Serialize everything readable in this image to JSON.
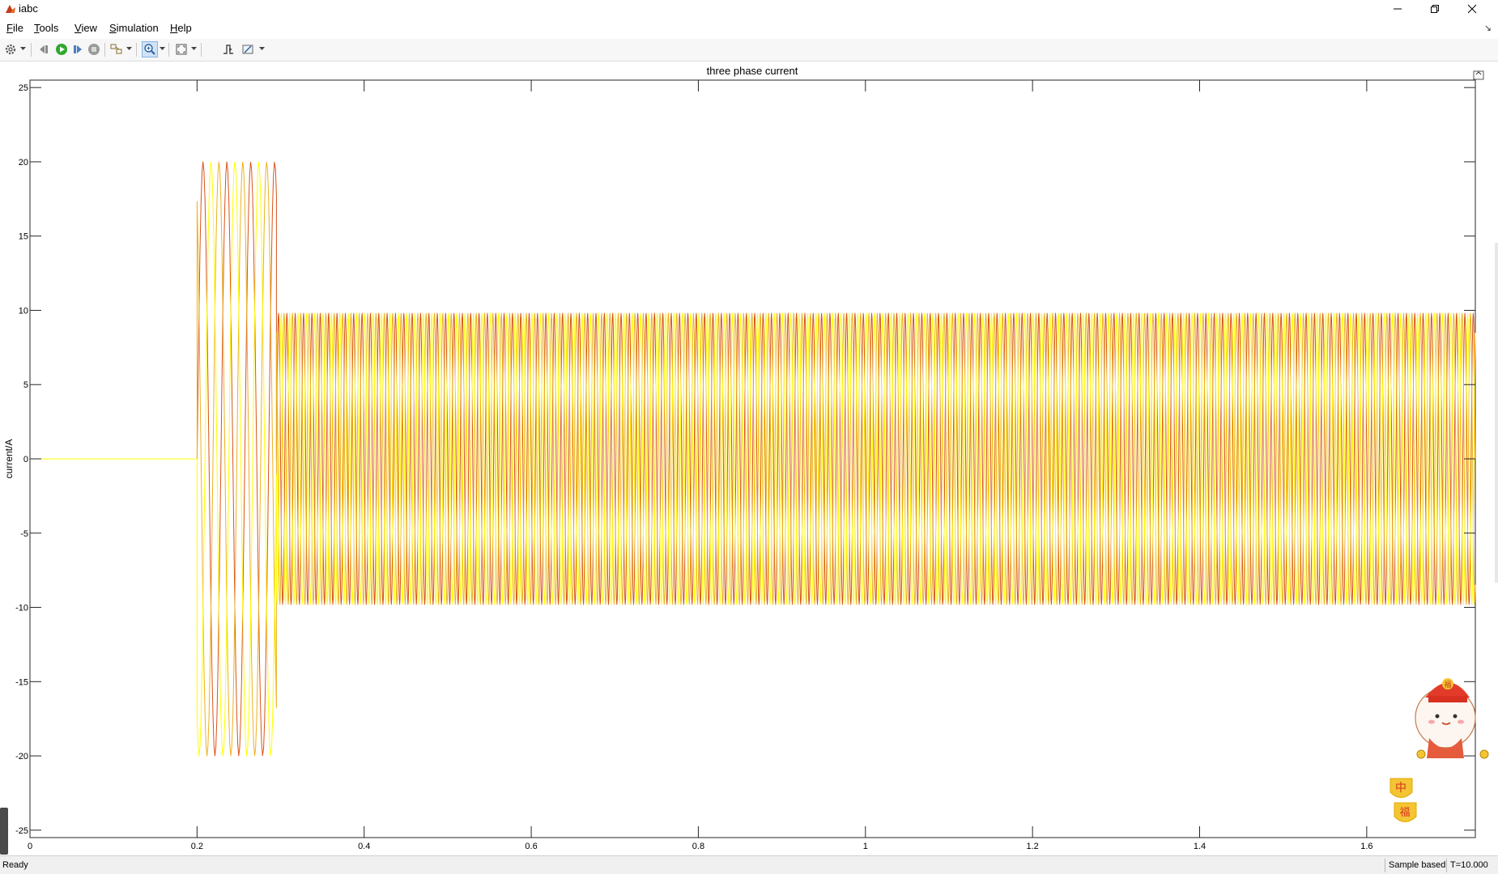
{
  "window": {
    "title": "iabc",
    "controls": {
      "minimize": "minimize",
      "restore": "restore",
      "close": "close"
    }
  },
  "menu": [
    {
      "label": "File",
      "mnemonic": "F",
      "rest": "ile"
    },
    {
      "label": "Tools",
      "mnemonic": "T",
      "rest": "ools"
    },
    {
      "label": "View",
      "mnemonic": "V",
      "rest": "iew"
    },
    {
      "label": "Simulation",
      "mnemonic": "S",
      "rest": "imulation"
    },
    {
      "label": "Help",
      "mnemonic": "H",
      "rest": "elp"
    }
  ],
  "toolbar": {
    "icons": [
      "settings-gear-icon",
      "step-back-icon",
      "run-icon",
      "step-forward-icon",
      "stop-icon",
      "highlight-block-icon",
      "zoom-in-icon",
      "autoscale-icon",
      "triggers-icon",
      "style-icon"
    ],
    "active": "zoom-in-icon",
    "run_color": "#2fa82f"
  },
  "status": {
    "ready": "Ready",
    "mode": "Sample based",
    "time": "T=10.000"
  },
  "chart_data": {
    "type": "line",
    "title": "three phase current",
    "xlabel": "",
    "ylabel": "current/A",
    "xlim": [
      0,
      1.73
    ],
    "ylim": [
      -25.5,
      25.5
    ],
    "xticks": [
      0,
      0.2,
      0.4,
      0.6,
      0.8,
      1,
      1.2,
      1.4,
      1.6
    ],
    "yticks": [
      25,
      20,
      15,
      10,
      5,
      0,
      -5,
      -10,
      -15,
      -20,
      -25
    ],
    "grid": false,
    "legend": "none",
    "series": [
      {
        "color": "#d95319",
        "segments": [
          {
            "x": [
              0,
              0.2
            ],
            "y": [
              0,
              0
            ]
          },
          {
            "x_start": 0.2,
            "x_end": 0.295,
            "amplitude": 20,
            "freq_hz": 35,
            "phase_deg": 0
          },
          {
            "x_start": 0.295,
            "x_end": 1.73,
            "amplitude": 9.8,
            "freq_hz": 100,
            "phase_deg": 0
          }
        ]
      },
      {
        "color": "#edb120",
        "segments": [
          {
            "x": [
              0,
              0.2
            ],
            "y": [
              0,
              0
            ]
          },
          {
            "x_start": 0.2,
            "x_end": 0.295,
            "amplitude": 20,
            "freq_hz": 35,
            "phase_deg": 120
          },
          {
            "x_start": 0.295,
            "x_end": 1.73,
            "amplitude": 9.8,
            "freq_hz": 100,
            "phase_deg": 120
          }
        ]
      },
      {
        "color": "#ffff00",
        "segments": [
          {
            "x": [
              0,
              0.2
            ],
            "y": [
              0,
              0
            ]
          },
          {
            "x_start": 0.2,
            "x_end": 0.295,
            "amplitude": 20,
            "freq_hz": 35,
            "phase_deg": 240
          },
          {
            "x_start": 0.295,
            "x_end": 1.73,
            "amplitude": 9.8,
            "freq_hz": 100,
            "phase_deg": 240
          }
        ]
      }
    ]
  },
  "overlay": {
    "badge_1": "中",
    "badge_2": "福",
    "mascot_hat_text": "福"
  }
}
